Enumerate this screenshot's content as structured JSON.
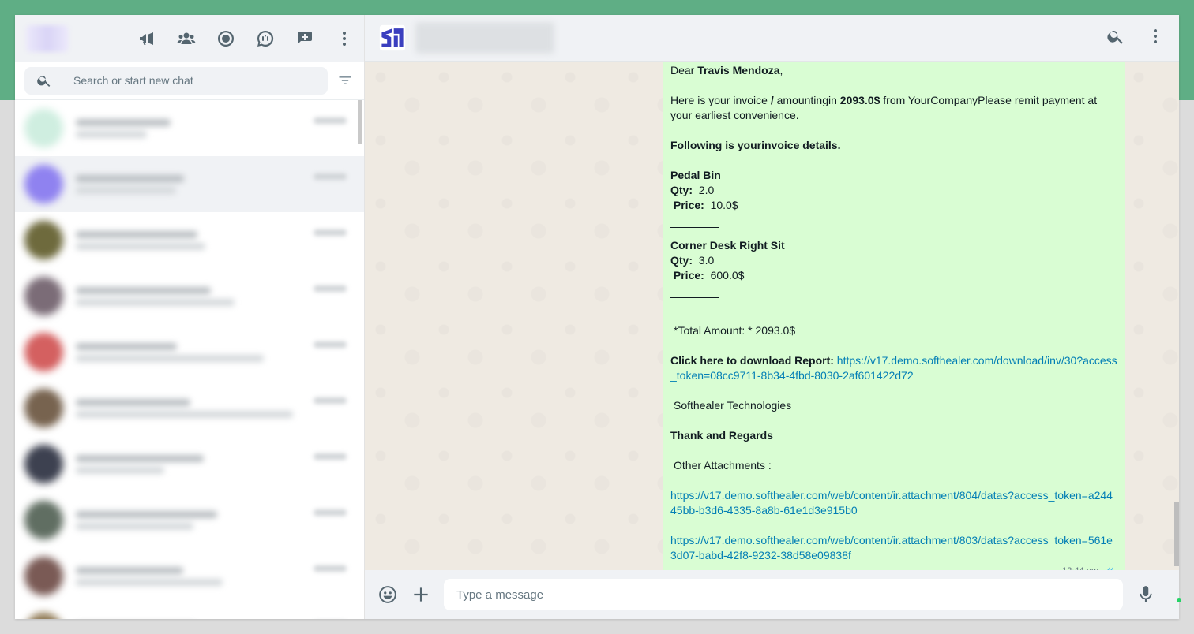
{
  "sidebar": {
    "search_placeholder": "Search or start new chat",
    "chats": [
      {
        "avatar_color": "#cfeee0"
      },
      {
        "avatar_color": "#8f82f0"
      },
      {
        "avatar_color": "#6e6a3d"
      },
      {
        "avatar_color": "#7b6c77"
      },
      {
        "avatar_color": "#d46060"
      },
      {
        "avatar_color": "#77634f"
      },
      {
        "avatar_color": "#3d4150"
      },
      {
        "avatar_color": "#606e62"
      },
      {
        "avatar_color": "#7a5a55"
      },
      {
        "avatar_color": "#907a55"
      }
    ]
  },
  "message": {
    "greeting_prefix": "Dear ",
    "customer_name": "Travis Mendoza",
    "greeting_suffix": ",",
    "intro_1": "Here is your invoice ",
    "intro_slash": "/",
    "intro_2": " amountingin ",
    "amount": "2093.0$",
    "intro_3": " from YourCompanyPlease remit payment at your earliest convenience.",
    "details_heading": "Following is yourinvoice details.",
    "items": [
      {
        "name": "Pedal Bin",
        "qty_label": "Qty:",
        "qty": "  2.0",
        "price_label": "Price:",
        "price": "  10.0$"
      },
      {
        "name": "Corner Desk Right Sit",
        "qty_label": "Qty:",
        "qty": "  3.0",
        "price_label": "Price:",
        "price": "  600.0$"
      }
    ],
    "total_line": "*Total Amount: * 2093.0$",
    "report_label": "Click here to download Report:",
    "report_link": "https://v17.demo.softhealer.com/download/inv/30?access_token=08cc9711-8b34-4fbd-8030-2af601422d72",
    "company": "Softhealer Technologies",
    "regards": "Thank and Regards",
    "attachments_label": "Other Attachments :",
    "attachment_links": [
      "https://v17.demo.softhealer.com/web/content/ir.attachment/804/datas?access_token=a24445bb-b3d6-4335-8a8b-61e1d3e915b0",
      "https://v17.demo.softhealer.com/web/content/ir.attachment/803/datas?access_token=561e3d07-babd-42f8-9232-38d58e09838f"
    ],
    "time": "12:44 pm"
  },
  "compose": {
    "placeholder": "Type a message"
  },
  "colors": {
    "accent_band": "#5fae85",
    "bubble": "#d9fdd3",
    "link": "#027eb5",
    "logo": "#3b3fbf"
  }
}
